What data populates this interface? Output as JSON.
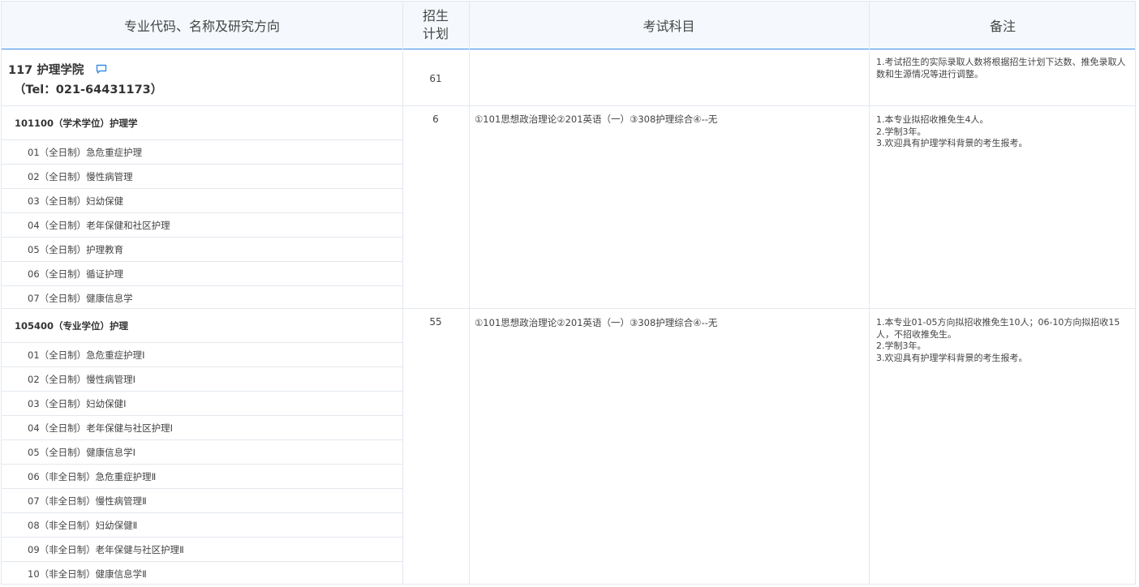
{
  "header": {
    "col1": "专业代码、名称及研究方向",
    "col2_line1": "招生",
    "col2_line2": "计划",
    "col3": "考试科目",
    "col4": "备注"
  },
  "college": {
    "name": "117 护理学院",
    "tel": "（Tel：021-64431173）",
    "plan": "61",
    "note": "1.考试招生的实际录取人数将根据招生计划下达数、推免录取人数和生源情况等进行调整。",
    "icon": "chat-bubble-icon",
    "accent": "#3a8ee6"
  },
  "majors": [
    {
      "title": "101100（学术学位）护理学",
      "plan": "6",
      "exam": "①101思想政治理论②201英语（一）③308护理综合④--无",
      "note": "1.本专业拟招收推免生4人。\n2.学制3年。\n3.欢迎具有护理学科背景的考生报考。",
      "directions": [
        "01（全日制）急危重症护理",
        "02（全日制）慢性病管理",
        "03（全日制）妇幼保健",
        "04（全日制）老年保健和社区护理",
        "05（全日制）护理教育",
        "06（全日制）循证护理",
        "07（全日制）健康信息学"
      ]
    },
    {
      "title": "105400（专业学位）护理",
      "plan": "55",
      "exam": "①101思想政治理论②201英语（一）③308护理综合④--无",
      "note": "1.本专业01-05方向拟招收推免生10人；06-10方向拟招收15人，不招收推免生。\n2.学制3年。\n3.欢迎具有护理学科背景的考生报考。",
      "directions": [
        "01（全日制）急危重症护理Ⅰ",
        "02（全日制）慢性病管理Ⅰ",
        "03（全日制）妇幼保健Ⅰ",
        "04（全日制）老年保健与社区护理Ⅰ",
        "05（全日制）健康信息学Ⅰ",
        "06（非全日制）急危重症护理Ⅱ",
        "07（非全日制）慢性病管理Ⅱ",
        "08（非全日制）妇幼保健Ⅱ",
        "09（非全日制）老年保健与社区护理Ⅱ",
        "10（非全日制）健康信息学Ⅱ"
      ]
    }
  ]
}
